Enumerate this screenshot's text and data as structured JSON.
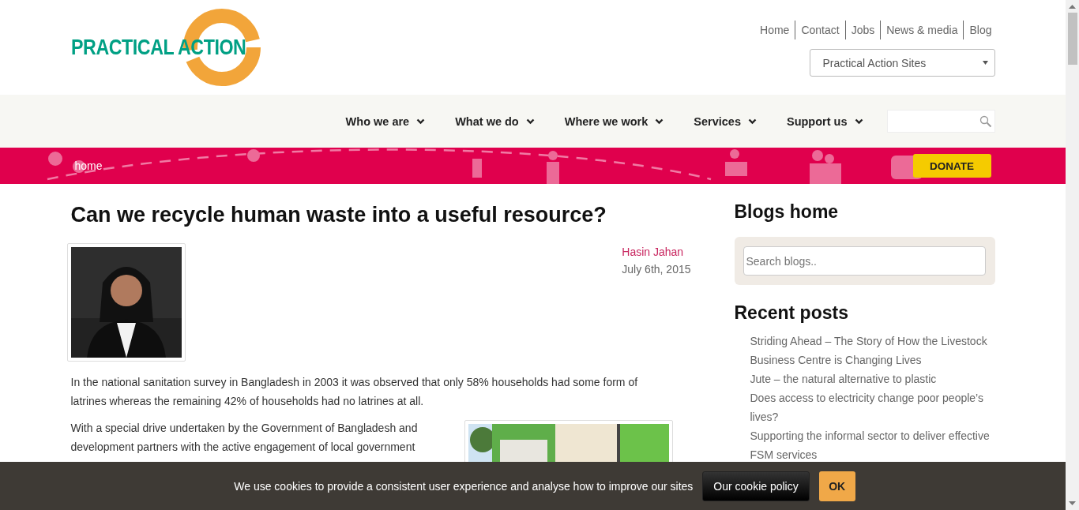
{
  "header": {
    "logo": "PRACTICAL ACTION",
    "top_links": [
      "Home",
      "Contact",
      "Jobs",
      "News & media",
      "Blog"
    ],
    "site_select": "Practical Action Sites"
  },
  "nav": {
    "items": [
      "Who we are",
      "What we do",
      "Where we work",
      "Services",
      "Support us"
    ]
  },
  "banner": {
    "breadcrumb": "home",
    "donate": "DONATE"
  },
  "article": {
    "title": "Can we recycle human waste into a useful resource?",
    "author": "Hasin Jahan",
    "date": "July 6th, 2015",
    "paragraphs": [
      "In the national sanitation survey in Bangladesh in 2003 it was observed that only 58% households had some form of latrines whereas the remaining 42% of households had no latrines at all.",
      "With a special drive undertaken by the Government of Bangladesh and development partners with the active engagement of local government"
    ]
  },
  "sidebar": {
    "blogs_title": "Blogs home",
    "search": {
      "placeholder": "Search blogs.."
    },
    "recent_title": "Recent posts",
    "recent_posts": [
      "Striding Ahead – The Story of How the Livestock Business Centre is Changing Lives",
      "Jute – the natural alternative to plastic",
      "Does access to electricity change poor people’s lives?",
      "Supporting the informal sector to deliver effective FSM services"
    ]
  },
  "cookie_bar": {
    "message": "We use cookies to provide a consistent user experience and analyse how to improve our sites",
    "policy": "Our cookie policy",
    "ok": "OK"
  }
}
